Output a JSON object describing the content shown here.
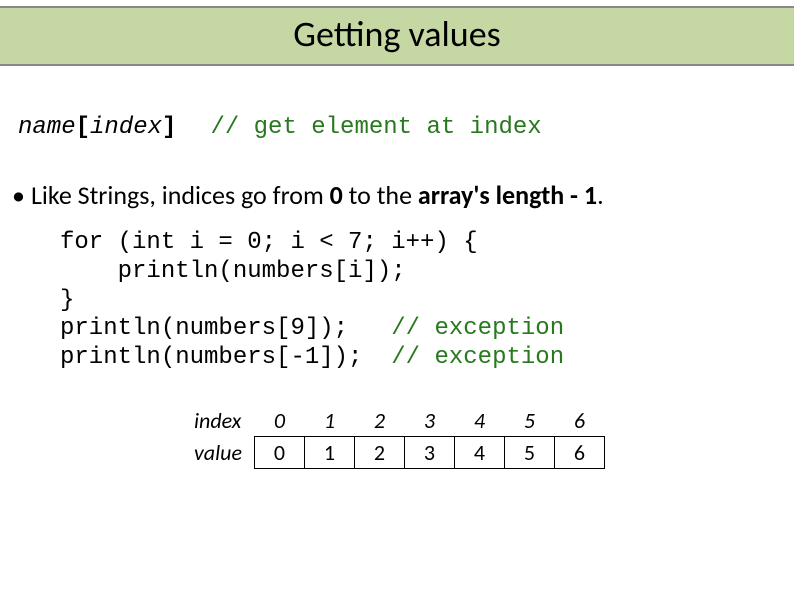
{
  "title": "Getting values",
  "syntax": {
    "name": "name",
    "open": "[",
    "index": "index",
    "close": "]",
    "comment": "// get element at index"
  },
  "bullet": {
    "text_before": "Like Strings, indices go from ",
    "zero": "0",
    "text_mid": " to the ",
    "bold_tail": "array's length - 1",
    "text_after": "."
  },
  "code": {
    "l1": "for (int i = 0; i < 7; i++) {",
    "l2": "    println(numbers[i]);",
    "l3": "}",
    "l4a": "println(numbers[9]);   ",
    "l4b": "// exception",
    "l5a": "println(numbers[-1]);  ",
    "l5b": "// exception"
  },
  "table": {
    "row_index_label": "index",
    "row_value_label": "value",
    "indices": [
      "0",
      "1",
      "2",
      "3",
      "4",
      "5",
      "6"
    ],
    "values": [
      "0",
      "1",
      "2",
      "3",
      "4",
      "5",
      "6"
    ]
  }
}
